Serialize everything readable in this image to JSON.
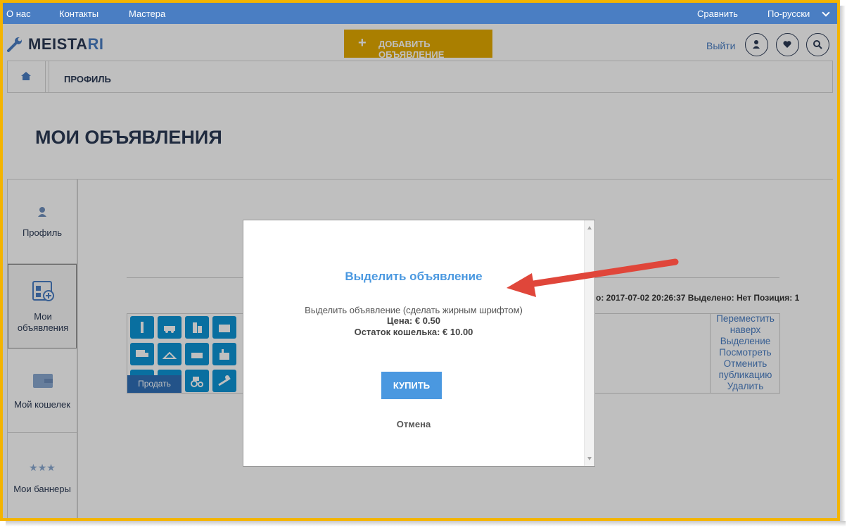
{
  "topbar": {
    "about": "О нас",
    "contacts": "Контакты",
    "masters": "Мастера",
    "compare": "Сравнить",
    "language": "По-русски"
  },
  "header": {
    "logo_main": "MEISTA",
    "logo_accent": "RI",
    "add_button": "ДОБАВИТЬ ОБЪЯВЛЕНИЕ",
    "add_plus": "+",
    "logout": "Выйти"
  },
  "breadcrumb": {
    "current": "ПРОФИЛЬ"
  },
  "page_title": "МОИ ОБЪЯВЛЕНИЯ",
  "sidebar": {
    "items": [
      {
        "label": "Профиль",
        "icon": "user-icon"
      },
      {
        "label": "Мои объявления",
        "icon": "ads-icon"
      },
      {
        "label": "Мой кошелек",
        "icon": "wallet-icon"
      },
      {
        "label": "Мои баннеры",
        "icon": "stars-icon"
      }
    ]
  },
  "listing": {
    "info_line": "о: 2017-07-02 20:26:37 Выделено: Нет Позиция: 1",
    "sell_button": "Продать",
    "actions": [
      "Переместить наверх",
      "Выделение",
      "Посмотреть",
      "Отменить публикацию",
      "Удалить"
    ]
  },
  "modal": {
    "title": "Выделить объявление",
    "description": "Выделить объявление (сделать жирным шрифтом)",
    "price": "Цена: € 0.50",
    "wallet": "Остаток кошелька: € 10.00",
    "buy": "КУПИТЬ",
    "cancel": "Отмена"
  },
  "colors": {
    "topbar": "#4a7ec3",
    "accent_button": "#e3aa00",
    "modal_accent": "#4a98e0",
    "frame": "#f4b400",
    "annotation_arrow": "#e0463a"
  }
}
